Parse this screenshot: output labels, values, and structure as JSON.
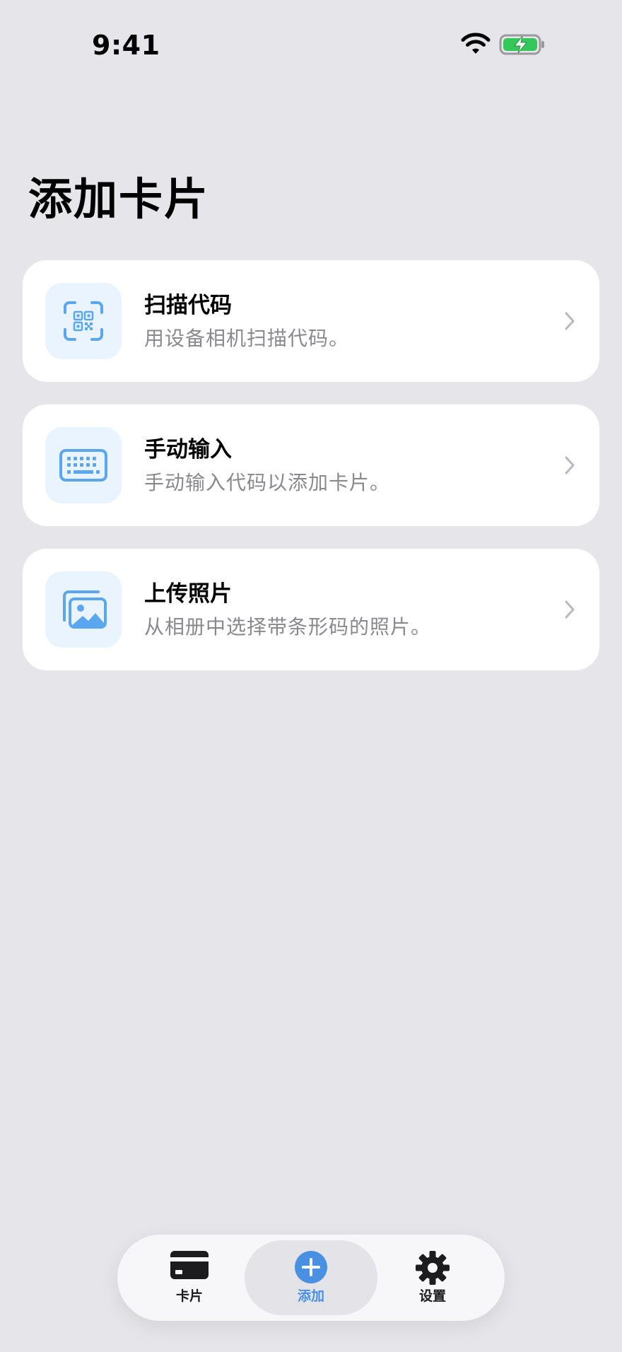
{
  "status_bar": {
    "time": "9:41"
  },
  "page": {
    "title": "添加卡片"
  },
  "options": [
    {
      "title": "扫描代码",
      "subtitle": "用设备相机扫描代码。",
      "icon": "qr-scan-icon"
    },
    {
      "title": "手动输入",
      "subtitle": "手动输入代码以添加卡片。",
      "icon": "keyboard-icon"
    },
    {
      "title": "上传照片",
      "subtitle": "从相册中选择带条形码的照片。",
      "icon": "photos-icon"
    }
  ],
  "tab_bar": {
    "items": [
      {
        "label": "卡片",
        "icon": "card-icon",
        "active": false
      },
      {
        "label": "添加",
        "icon": "plus-circle-icon",
        "active": true
      },
      {
        "label": "设置",
        "icon": "gear-icon",
        "active": false
      }
    ]
  },
  "colors": {
    "background": "#E5E5EA",
    "card": "#FFFFFF",
    "accent": "#4A90E2",
    "icon_tint": "#5AA7EF",
    "icon_bg": "#EAF4FF",
    "secondary_text": "#8A8A8E",
    "battery_green": "#34C759"
  }
}
